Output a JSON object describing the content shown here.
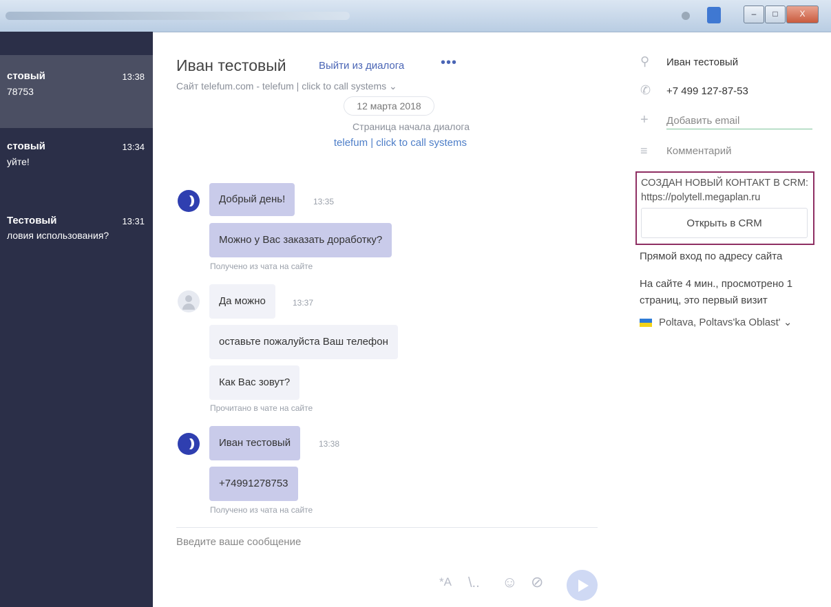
{
  "window": {
    "minimize": "–",
    "maximize": "□",
    "close": "X"
  },
  "sidebar": {
    "conversations": [
      {
        "name": "стовый",
        "time": "13:38",
        "preview": "78753"
      },
      {
        "name": "стовый",
        "time": "13:34",
        "preview": "уйте!"
      },
      {
        "name": "Тестовый",
        "time": "13:31",
        "preview": "ловия использования?"
      }
    ]
  },
  "header": {
    "name": "Иван тестовый",
    "exit_label": "Выйти из диалога",
    "more_icon": "•••",
    "site": "Сайт telefum.com - telefum | click to call systems",
    "site_chevron": "⌄"
  },
  "chat": {
    "date": "12 марта 2018",
    "start_label": "Страница начала диалога",
    "start_link": "telefum | click to call systems",
    "messages": [
      {
        "text": "Добрый день!",
        "time": "13:35"
      },
      {
        "text": "Можно у Вас заказать доработку?"
      },
      {
        "meta": "Получено из чата на сайте"
      },
      {
        "text": "Да можно",
        "time": "13:37"
      },
      {
        "text": "оставьте пожалуйста Ваш телефон"
      },
      {
        "text": "Как Вас зовут?"
      },
      {
        "meta": "Прочитано в чате на сайте"
      },
      {
        "text": "Иван тестовый",
        "time": "13:38"
      },
      {
        "text": "+74991278753"
      },
      {
        "meta": "Получено из чата на сайте"
      }
    ]
  },
  "composer": {
    "placeholder": "Введите ваше сообщение",
    "tools": {
      "translate": "*A",
      "template": "\\..",
      "emoji": "☺",
      "attach": "⊘"
    }
  },
  "contact": {
    "icons": {
      "person": "⚲",
      "phone": "✆",
      "plus": "+",
      "comment": "≡"
    },
    "name": "Иван тестовый",
    "phone": "+7 499 127-87-53",
    "add_email": "Добавить email",
    "comment": "Комментарий",
    "crm_notice": "СОЗДАН НОВЫЙ КОНТАКТ В CRM: https://polytell.megaplan.ru",
    "crm_button": "Открыть в CRM",
    "entry": "Прямой вход по адресу сайта",
    "visit": "На сайте 4 мин., просмотрено 1 страниц, это первый визит",
    "location": "Poltava, Poltavs'ka Oblast'",
    "location_chevron": "⌄"
  },
  "colors": {
    "sidebar": "#2b2f48",
    "operator_bubble": "#c9cbea",
    "client_bubble": "#f1f2f8",
    "accent": "#4a65b5",
    "crm_border": "#8e2e62"
  }
}
